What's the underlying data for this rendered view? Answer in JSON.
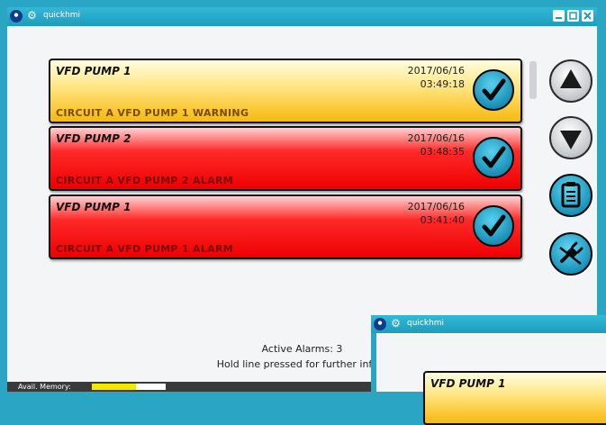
{
  "window": {
    "title": "quickhmi"
  },
  "alarms": [
    {
      "name": "VFD PUMP 1",
      "date": "2017/06/16",
      "time": "03:49:18",
      "message": "CIRCUIT A VFD PUMP 1 WARNING",
      "severity": "warning"
    },
    {
      "name": "VFD PUMP 2",
      "date": "2017/06/16",
      "time": "03:48:35",
      "message": "CIRCUIT A VFD PUMP 2 ALARM",
      "severity": "alarm"
    },
    {
      "name": "VFD PUMP 1",
      "date": "2017/06/16",
      "time": "03:41:40",
      "message": "CIRCUIT A VFD PUMP 1 ALARM",
      "severity": "alarm"
    }
  ],
  "footer": {
    "active_alarms": "Active Alarms: 3",
    "hint": "Hold line pressed for further info o"
  },
  "status_bar": {
    "memory_label": "Avail. Memory:",
    "memory_fraction": 0.6
  },
  "second_window": {
    "title": "quickhmi",
    "alarm_name": "VFD PUMP 1"
  },
  "icons": [
    "logo-icon",
    "gear-icon",
    "minimize-icon",
    "maximize-icon",
    "close-icon",
    "checkmark-icon",
    "arrow-up-icon",
    "arrow-down-icon",
    "clipboard-icon",
    "disconnect-plug-icon"
  ],
  "colors": {
    "warning": "#f7b90d",
    "alarm": "#ee0000",
    "accent": "#2aa5c4"
  }
}
